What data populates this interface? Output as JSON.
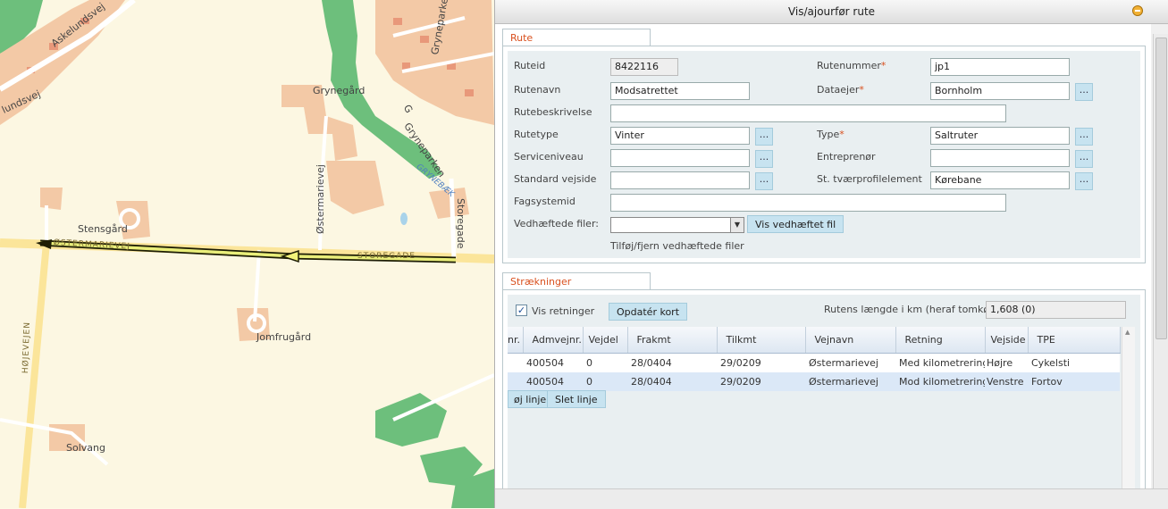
{
  "map": {
    "labels": {
      "askelundsvej": "Askelundsvej",
      "lundsvej": "lundsvej",
      "grynegaard": "Grynegård",
      "gryneparken_top": "Gryneparken",
      "gryneparken_mid": "Gryneparken",
      "gryneparken_g": "G",
      "grynebaek": "GRYNEBÆK",
      "ostermarievej_v": "Østermarievej",
      "storegade_right": "Storegade",
      "stensgaard": "Stensgård",
      "ostermarievej_road": "ØSTERMARIEVEJ",
      "storegade_road": "STOREGADE",
      "hojevejen": "HØJEVEJEN",
      "jomfrugaard": "Jomfrugård",
      "solvang": "Solvang"
    }
  },
  "dialog": {
    "title": "Vis/ajourfør rute",
    "rute_tab": "Rute",
    "fields": {
      "ruteid_label": "Ruteid",
      "ruteid_value": "8422116",
      "rutenummer_label": "Rutenummer",
      "rutenummer_value": "jp1",
      "rutenavn_label": "Rutenavn",
      "rutenavn_value": "Modsatrettet",
      "dataejer_label": "Dataejer",
      "dataejer_value": "Bornholm",
      "rutebeskrivelse_label": "Rutebeskrivelse",
      "rutebeskrivelse_value": "",
      "rutetype_label": "Rutetype",
      "rutetype_value": "Vinter",
      "type_label": "Type",
      "type_value": "Saltruter",
      "serviceniveau_label": "Serviceniveau",
      "serviceniveau_value": "",
      "entreprenor_label": "Entreprenør",
      "entreprenor_value": "",
      "standard_vejside_label": "Standard vejside",
      "standard_vejside_value": "",
      "st_tvaer_label": "St. tværprofilelement",
      "st_tvaer_value": "Kørebane",
      "fagsystemid_label": "Fagsystemid",
      "fagsystemid_value": "",
      "vedhaeftede_label": "Vedhæftede filer:",
      "vedhaeftede_value": "",
      "vis_vedhaeftet_button": "Vis vedhæftet fil",
      "tilfoj_fjern_text": "Tilføj/fjern vedhæftede filer",
      "required_mark": "*",
      "dots": "..."
    },
    "straekninger": {
      "tab": "Strækninger",
      "vis_retninger_label": "Vis retninger",
      "vis_retninger_checked": true,
      "opdater_kort_button": "Opdatér kort",
      "rutens_laengde_label": "Rutens længde i km (heraf tomkørsel)",
      "rutens_laengde_value": "1,608 (0)",
      "columns": [
        "nr.",
        "Admvejnr.",
        "Vejdel",
        "Frakmt",
        "Tilkmt",
        "Vejnavn",
        "Retning",
        "Vejside",
        "TPE"
      ],
      "rows": [
        [
          "",
          "400504",
          "0",
          "28/0404",
          "29/0209",
          "Østermarievej",
          "Med kilometrering",
          "Højre",
          "Cykelsti"
        ],
        [
          "",
          "400504",
          "0",
          "28/0404",
          "29/0209",
          "Østermarievej",
          "Mod kilometrering",
          "Venstre",
          "Fortov"
        ]
      ],
      "tilfoj_linje_button": "øj linje",
      "slet_linje_button": "Slet linje"
    }
  },
  "colors": {
    "accent_orange": "#d9501e",
    "button_blue": "#c7e3f0",
    "row_alt": "#dbe8f7",
    "route_line": "#e9ee7a"
  }
}
